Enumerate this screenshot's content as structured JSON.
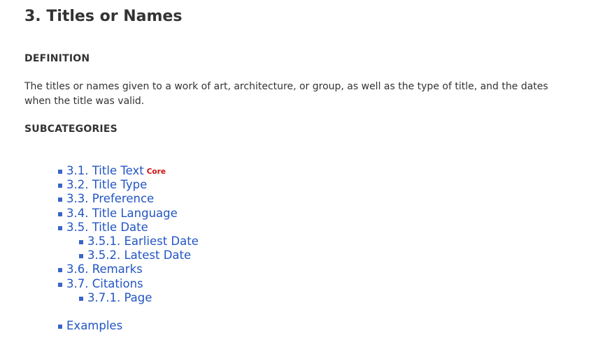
{
  "title": "3. Titles or Names",
  "definition": {
    "heading": "DEFINITION",
    "text": "The titles or names given to a work of art, architecture, or group, as well as the type of title, and the dates when the title was valid."
  },
  "subcategories": {
    "heading": "SUBCATEGORIES",
    "items": [
      {
        "label": "3.1. Title Text",
        "badge": "Core"
      },
      {
        "label": "3.2. Title Type"
      },
      {
        "label": "3.3. Preference"
      },
      {
        "label": "3.4. Title Language"
      },
      {
        "label": "3.5. Title Date"
      },
      {
        "label": "3.5.1. Earliest Date"
      },
      {
        "label": "3.5.2. Latest Date"
      },
      {
        "label": "3.6. Remarks"
      },
      {
        "label": "3.7. Citations"
      },
      {
        "label": "3.7.1. Page"
      }
    ],
    "examples_label": "Examples"
  },
  "colors": {
    "link": "#2255c4",
    "bullet": "#3a64c8",
    "badge": "#cc1111",
    "text": "#333333"
  }
}
